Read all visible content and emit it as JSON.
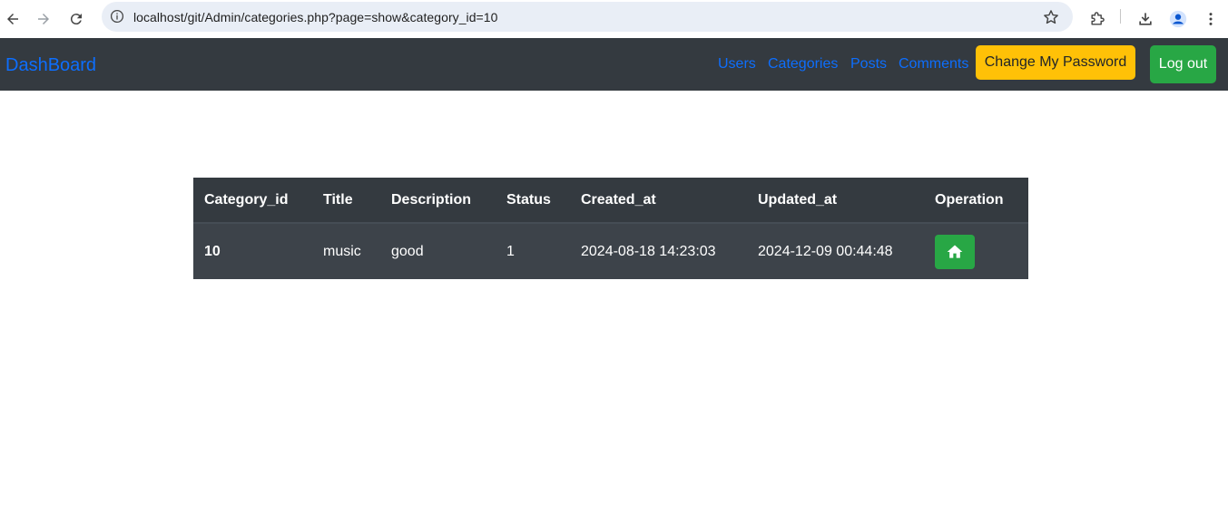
{
  "browser": {
    "url": "localhost/git/Admin/categories.php?page=show&category_id=10",
    "icons": [
      "back-arrow-icon",
      "forward-arrow-icon",
      "reload-icon",
      "site-info-icon",
      "bookmark-star-icon",
      "extensions-icon",
      "download-icon",
      "profile-icon",
      "menu-dots-icon"
    ]
  },
  "navbar": {
    "brand": "DashBoard",
    "links": [
      "Users",
      "Categories",
      "Posts",
      "Comments"
    ],
    "change_password": "Change My Password",
    "logout": "Log out",
    "colors": {
      "bg": "#343a40",
      "link": "#0d6efd",
      "warning": "#ffc107",
      "success": "#28a745"
    }
  },
  "table": {
    "headers": [
      "Category_id",
      "Title",
      "Description",
      "Status",
      "Created_at",
      "Updated_at",
      "Operation"
    ],
    "rows": [
      {
        "category_id": "10",
        "title": "music",
        "description": "good",
        "status": "1",
        "created_at": "2024-08-18 14:23:03",
        "updated_at": "2024-12-09 00:44:48",
        "operation_icon": "home-icon"
      }
    ]
  }
}
